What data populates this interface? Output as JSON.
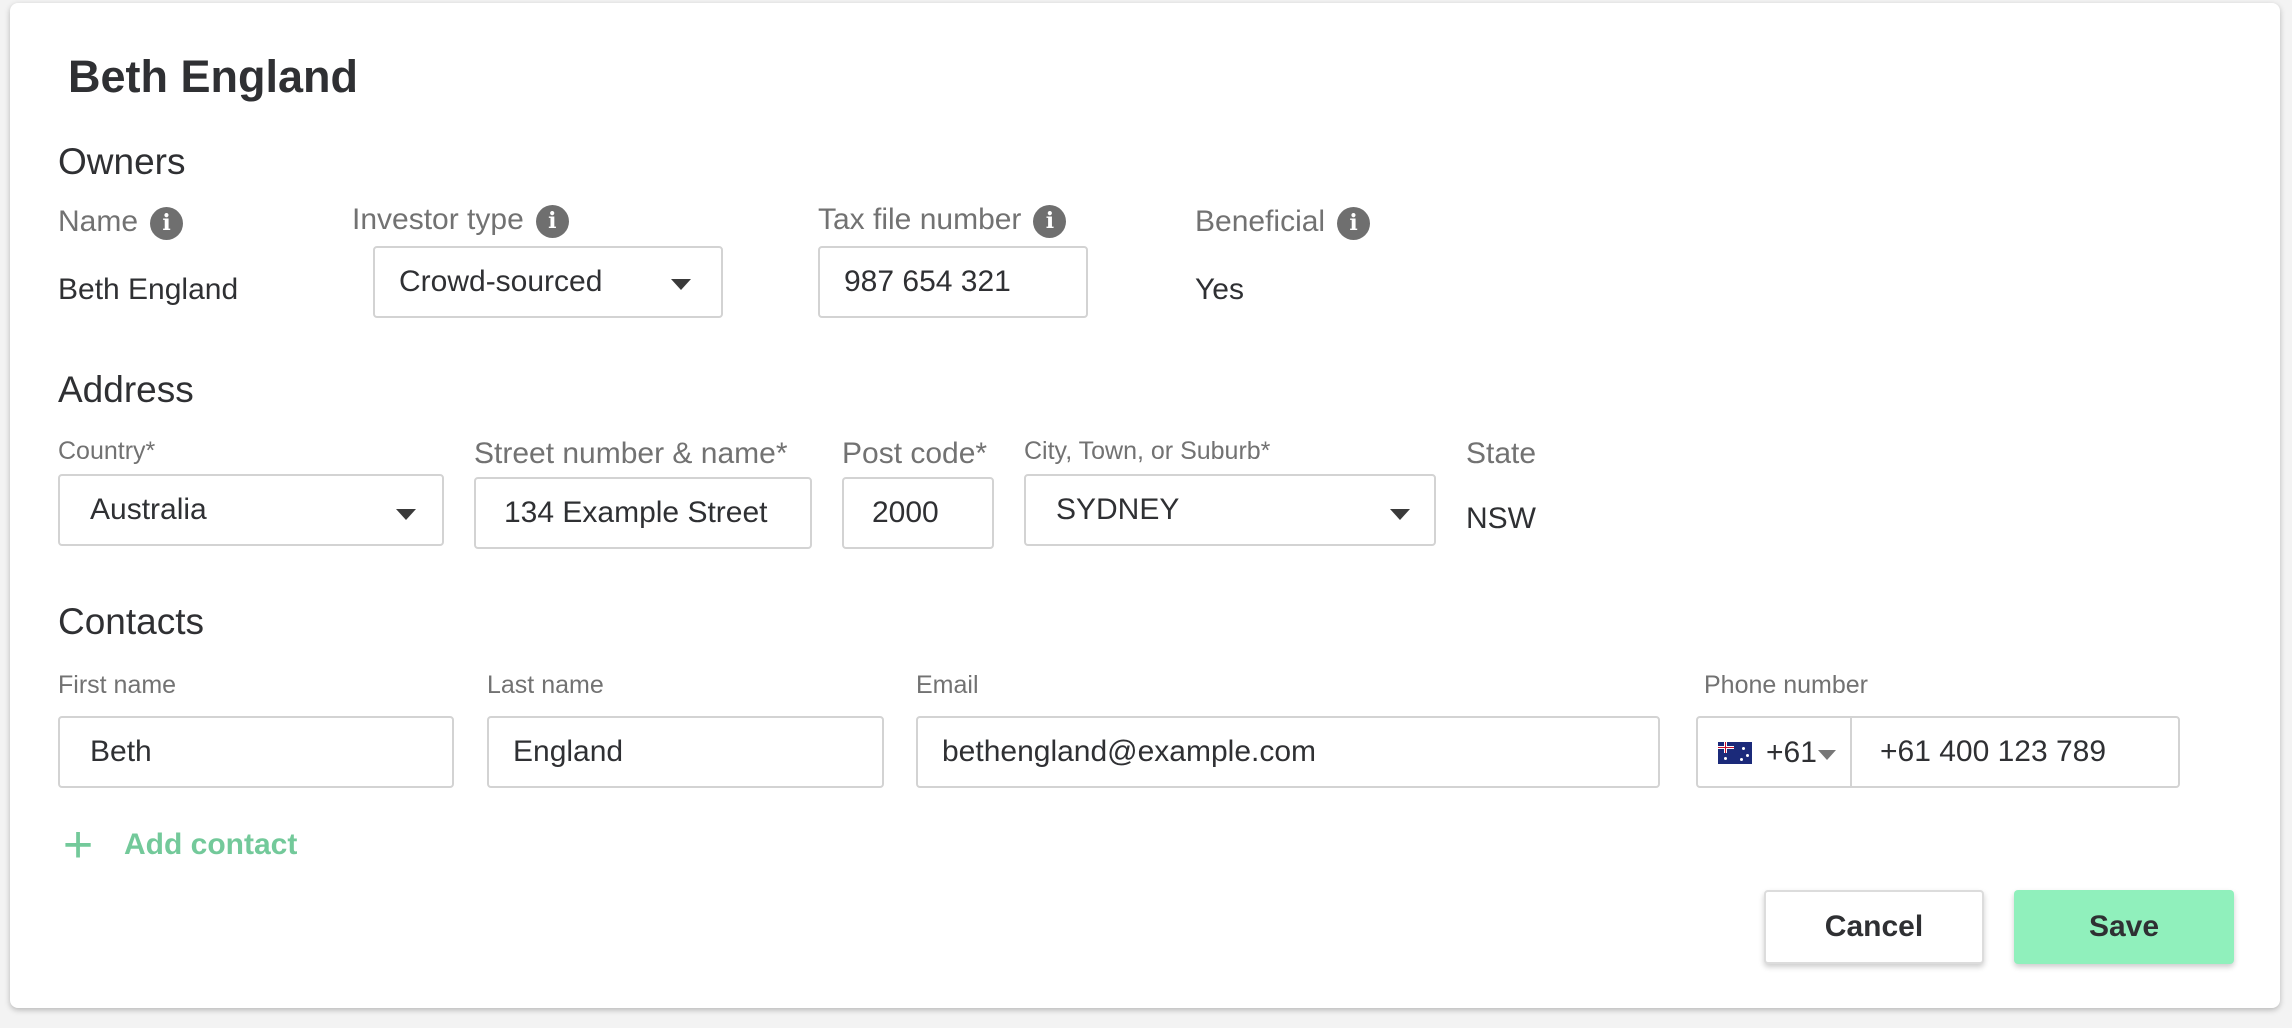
{
  "header": {
    "title": "Beth England"
  },
  "owners": {
    "section_title": "Owners",
    "name_label": "Name",
    "name_value": "Beth England",
    "investor_type_label": "Investor type",
    "investor_type_value": "Crowd-sourced",
    "tax_file_label": "Tax file number",
    "tax_file_value": "987 654 321",
    "beneficial_label": "Beneficial",
    "beneficial_value": "Yes",
    "info_glyph": "i"
  },
  "address": {
    "section_title": "Address",
    "country_label": "Country*",
    "country_value": "Australia",
    "street_label": "Street number & name*",
    "street_value": "134 Example Street",
    "postcode_label": "Post code*",
    "postcode_value": "2000",
    "city_label": "City, Town, or Suburb*",
    "city_value": "SYDNEY",
    "state_label": "State",
    "state_value": "NSW"
  },
  "contacts": {
    "section_title": "Contacts",
    "first_name_label": "First name",
    "first_name_value": "Beth",
    "last_name_label": "Last name",
    "last_name_value": "England",
    "email_label": "Email",
    "email_value": "bethengland@example.com",
    "phone_label": "Phone number",
    "phone_country_code": "+61",
    "phone_value": "+61 400 123 789",
    "add_contact_label": "Add contact",
    "add_icon": "+"
  },
  "actions": {
    "cancel_label": "Cancel",
    "save_label": "Save"
  },
  "colors": {
    "accent_green": "#90f0bc",
    "link_green": "#73c99a"
  }
}
